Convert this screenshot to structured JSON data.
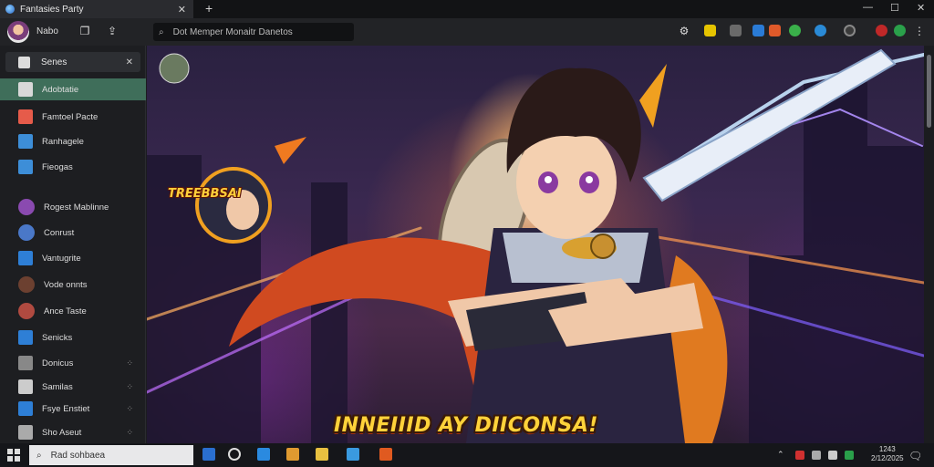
{
  "window": {
    "tab_title": "Fantasies Party",
    "tab_close_glyph": "✕",
    "new_tab_glyph": "+",
    "controls": {
      "minimize": "—",
      "maximize": "☐",
      "close": "✕"
    }
  },
  "toolbar": {
    "profile_label": "Nabo",
    "search_placeholder": "Dot Memper  Monaitr  Danetos",
    "search_icon": "search-icon"
  },
  "sidebar": {
    "search_label": "Senes",
    "items": [
      {
        "label": "Adobtatie",
        "icon": "doc-icon",
        "active": true,
        "color": "#d8d8d8"
      },
      {
        "label": "Famtoel Pacte",
        "icon": "file-icon",
        "color": "#e65b4a"
      },
      {
        "label": "Ranhagele",
        "icon": "folder-icon",
        "color": "#3d8ed8"
      },
      {
        "label": "Fieogas",
        "icon": "image-icon",
        "color": "#3d8ed8"
      },
      {
        "label": "Rogest Mablinne",
        "avatar": true,
        "color": "#8a4ab0"
      },
      {
        "label": "Conrust",
        "avatar": true,
        "color": "#4a78c8"
      },
      {
        "label": "Vantugrite",
        "icon": "play-icon",
        "color": "#2e7fd6"
      },
      {
        "label": "Vode onnts",
        "avatar": true,
        "color": "#6c4030"
      },
      {
        "label": "Ance Taste",
        "avatar": true,
        "color": "#b04a40"
      },
      {
        "label": "Senicks",
        "icon": "send-icon",
        "color": "#2e7fd6"
      },
      {
        "label": "Donicus",
        "icon": "circle-icon",
        "color": "#888888",
        "pin": "⁘"
      },
      {
        "label": "Samilas",
        "icon": "folder-icon",
        "color": "#cccccc",
        "pin": "⁘"
      },
      {
        "label": "Fsye Enstiet",
        "icon": "monitor-icon",
        "color": "#2e7fd6",
        "pin": "⁘"
      },
      {
        "label": "Sho Aseut",
        "icon": "globe-icon",
        "color": "#aaaaaa",
        "pin": "⁘"
      }
    ]
  },
  "content": {
    "caption": "INNEIIID AY DIICONSA!",
    "badge_text": "TREEBBSAI"
  },
  "taskbar": {
    "search_placeholder": "Rad sohbaea",
    "clock_time": "1243",
    "clock_date": "2/12/2025"
  },
  "colors": {
    "sidebar_active": "#3f6e5a",
    "caption_yellow": "#ffd23a",
    "background": "#1b1c1f"
  }
}
